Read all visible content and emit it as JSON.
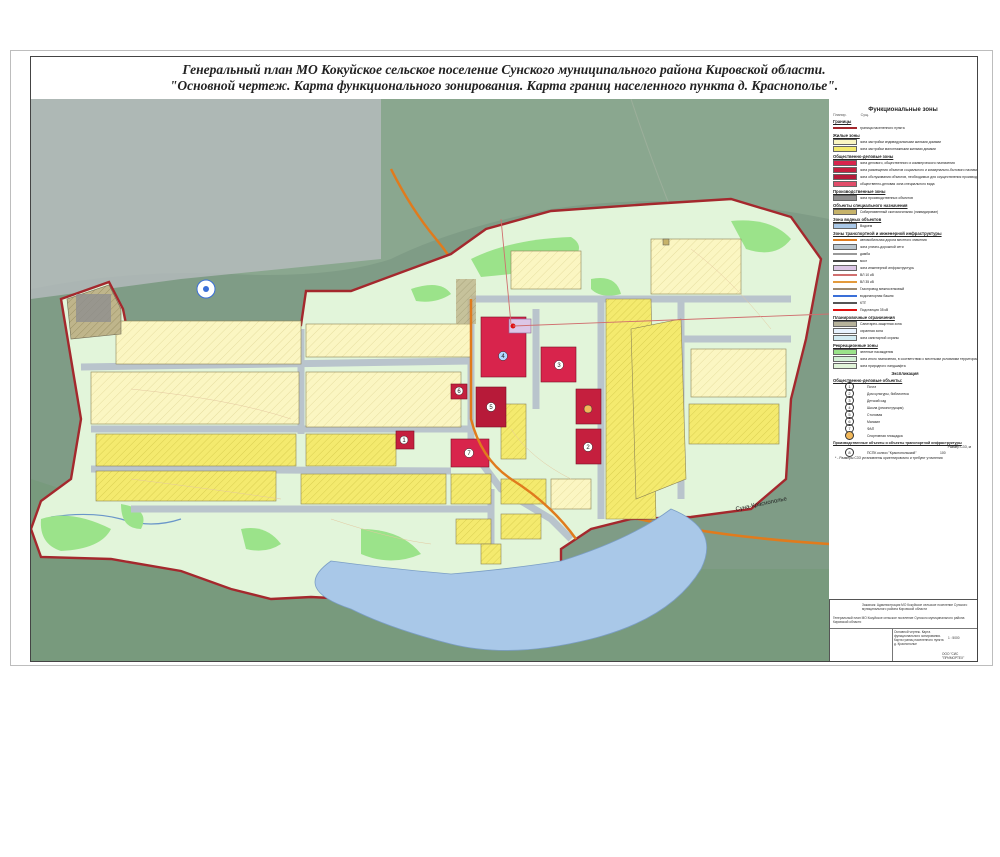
{
  "title": {
    "line1": "Генеральный план МО Кокуйское сельское поселение Сунского муниципального района Кировской области.",
    "line2": "\"Основной чертеж. Карта функционального зонирования. Карта границ населенного пункта д. Краснополье\"."
  },
  "map": {
    "road_label": "Суна-Краснополье",
    "objects": [
      "1",
      "2",
      "3",
      "4",
      "5",
      "6",
      "7"
    ]
  },
  "legend": {
    "heading": "Функциональные зоны",
    "sub_left": "Планир.",
    "sub_right": "Сущ.",
    "sections": [
      {
        "title": "Границы",
        "rows": [
          {
            "type": "line",
            "color": "#a4282d",
            "label": "граница населенного пункта"
          }
        ]
      },
      {
        "title": "Жилые зоны",
        "rows": [
          {
            "type": "swatch",
            "color": "#fbf6c2",
            "label": "зона застройки индивидуальными жилыми домами"
          },
          {
            "type": "swatch",
            "color": "#f4ea6e",
            "label": "зона застройки малоэтажными жилыми домами"
          }
        ]
      },
      {
        "title": "Общественно-деловые зоны",
        "rows": [
          {
            "type": "swatch",
            "color": "#d8244c",
            "label": "зона делового, общественного и коммерческого назначения"
          },
          {
            "type": "swatch",
            "color": "#c51f3e",
            "label": "зона размещения объектов социального и коммунально-бытового назначения"
          },
          {
            "type": "swatch",
            "color": "#b71a39",
            "label": "зона обслуживания объектов, необходимых для осуществления производственной и предпринимательской деятельности"
          },
          {
            "type": "swatch",
            "color": "#e24d6a",
            "label": "общественно-деловая зона специального вида"
          }
        ]
      },
      {
        "title": "Производственные зоны",
        "rows": [
          {
            "type": "swatch",
            "color": "#8f8f8f",
            "label": "зона производственных объектов"
          }
        ]
      },
      {
        "title": "Объекты специального назначения",
        "rows": [
          {
            "type": "swatch",
            "color": "#c7b36a",
            "label": "Сибиреязвенный скотомогильник (ликвидирован)"
          }
        ]
      },
      {
        "title": "Зона водных объектов",
        "rows": [
          {
            "type": "swatch",
            "color": "#a9c8e8",
            "label": "Водоем"
          }
        ]
      },
      {
        "title": "Зоны транспортной и инженерной инфраструктуры",
        "rows": [
          {
            "type": "line",
            "color": "#e07b1d",
            "label": "автомобильная дорога местного значения"
          },
          {
            "type": "swatch",
            "color": "#b9c4cc",
            "label": "зона улично-дорожной сети"
          },
          {
            "type": "line",
            "color": "#999999",
            "label": "дамба"
          },
          {
            "type": "line",
            "color": "#444444",
            "label": "мост"
          },
          {
            "type": "swatch",
            "color": "#dcc6e6",
            "label": "зона инженерной инфраструктуры"
          },
          {
            "type": "line",
            "color": "#d06f6f",
            "label": "ВЛ 10 кВ"
          },
          {
            "type": "line",
            "color": "#e39a3c",
            "label": "ВЛ 35 кВ"
          },
          {
            "type": "line",
            "color": "#9a8a75",
            "label": "Газопровод межпоселковый"
          },
          {
            "type": "line",
            "color": "#3a6fd8",
            "label": "водонапорная башня"
          },
          {
            "type": "line",
            "color": "#555555",
            "label": "КТП"
          },
          {
            "type": "line",
            "color": "#e01010",
            "label": "Подстанция 35 кВ"
          }
        ]
      },
      {
        "title": "Планировочные ограничения",
        "rows": [
          {
            "type": "swatch",
            "color": "#b7b39b",
            "label": "Санитарно-защитная зона"
          },
          {
            "type": "swatch",
            "color": "#e8f3ff",
            "label": "охранная зона"
          },
          {
            "type": "swatch",
            "color": "#d3ecf3",
            "label": "зона санитарной охраны"
          }
        ]
      },
      {
        "title": "Рекреационные зоны",
        "rows": [
          {
            "type": "swatch",
            "color": "#9be38a",
            "label": "зеленые насаждения"
          },
          {
            "type": "swatch",
            "color": "#d4f0d6",
            "label": "зона иного назначения, в соответствии с местными условиями территории"
          },
          {
            "type": "swatch",
            "color": "#e2f5da",
            "label": "зона природного ландшафта"
          }
        ]
      }
    ],
    "explication_title": "Экспликация",
    "objects_title": "Общественно-деловые объекты:",
    "objects": [
      {
        "n": "1",
        "label": "Почта"
      },
      {
        "n": "2",
        "label": "Дом культуры, библиотека"
      },
      {
        "n": "3",
        "label": "Детский сад"
      },
      {
        "n": "4",
        "label": "Школа (реконструкция)"
      },
      {
        "n": "5",
        "label": "Столовая"
      },
      {
        "n": "6",
        "label": "Магазин"
      },
      {
        "n": "7",
        "label": "ФАП"
      },
      {
        "n": "",
        "label": "Спортивная площадка"
      }
    ],
    "prod_title": "Производственные объекты и объекты транспортной инфраструктуры",
    "prod_size_head": "Размер СЗЗ, м",
    "prod_objects": [
      {
        "n": "8",
        "label": "ПСПК колхоз \"Краснопольский\"",
        "size": "100"
      }
    ],
    "footnote": "* - Размеры СЗЗ установлены ориентировочно и требуют уточнения"
  },
  "stamp": {
    "org": "Заказчик: Администрация МО Кокуйское сельское поселение Сунского муниципального района Кировской области",
    "project": "Генеральный план МО Кокуйское сельское поселение Сунского муниципального района Кировской области",
    "sheet_name": "Основной чертеж. Карта функционального зонирования. Карта границ населенного пункта д. Краснополье",
    "scale": "1 : 5000",
    "firm": "ООО \"СИС \"ПРИМОРТЕХ\""
  },
  "colors": {
    "boundary": "#a4282d",
    "residential_ind": "#fbf6c2",
    "residential_low": "#f4ea6e",
    "public": "#d8244c",
    "landscape": "#e2f5da",
    "green": "#9be38a",
    "water": "#a9c8e8",
    "road": "#e07b1d"
  }
}
